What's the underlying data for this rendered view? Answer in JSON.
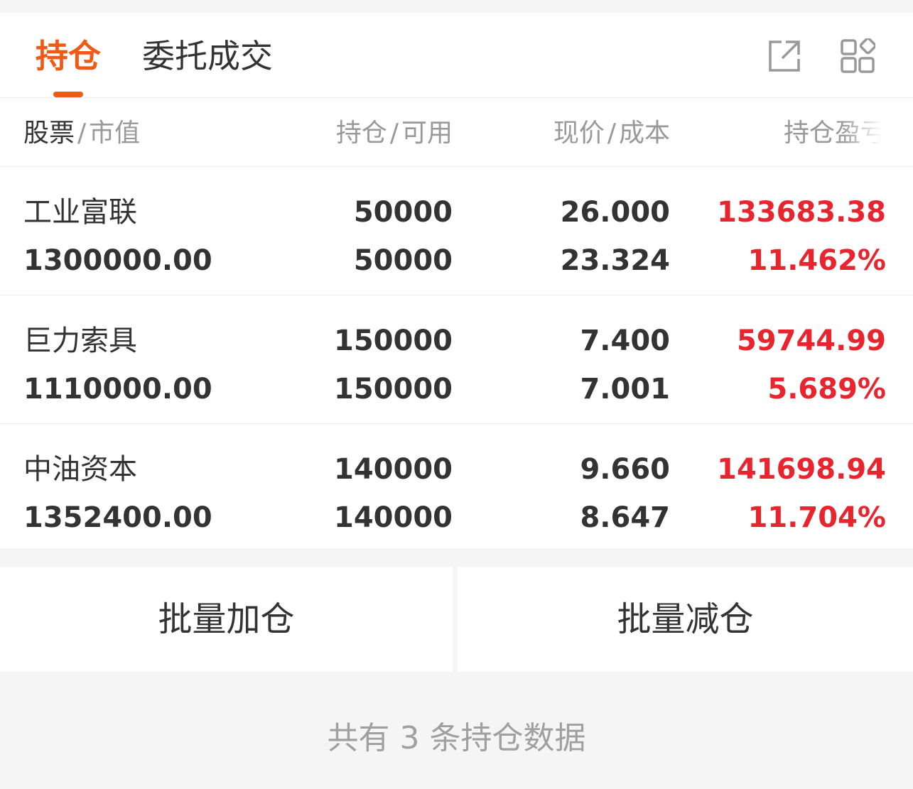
{
  "tabs": {
    "active_label": "持仓",
    "inactive_label": "委托成交"
  },
  "icons": {
    "share": "share-external-icon",
    "apps": "apps-grid-icon"
  },
  "colors": {
    "accent": "#f05a16",
    "profit": "#e8252e",
    "text": "#333333",
    "muted": "#999999"
  },
  "table": {
    "headers": {
      "stock_main": "股票",
      "stock_sub": "市值",
      "position_main": "持仓",
      "position_sub": "可用",
      "price_main": "现价",
      "price_sub": "成本",
      "pl": "持仓盈亏"
    },
    "separator": "/",
    "rows": [
      {
        "name": "工业富联",
        "market_value": "1300000.00",
        "position": "50000",
        "available": "50000",
        "price": "26.000",
        "cost": "23.324",
        "pl_amount": "133683.38",
        "pl_percent": "11.462%"
      },
      {
        "name": "巨力索具",
        "market_value": "1110000.00",
        "position": "150000",
        "available": "150000",
        "price": "7.400",
        "cost": "7.001",
        "pl_amount": "59744.99",
        "pl_percent": "5.689%"
      },
      {
        "name": "中油资本",
        "market_value": "1352400.00",
        "position": "140000",
        "available": "140000",
        "price": "9.660",
        "cost": "8.647",
        "pl_amount": "141698.94",
        "pl_percent": "11.704%"
      }
    ]
  },
  "actions": {
    "batch_add": "批量加仓",
    "batch_reduce": "批量减仓"
  },
  "summary": "共有 3 条持仓数据"
}
